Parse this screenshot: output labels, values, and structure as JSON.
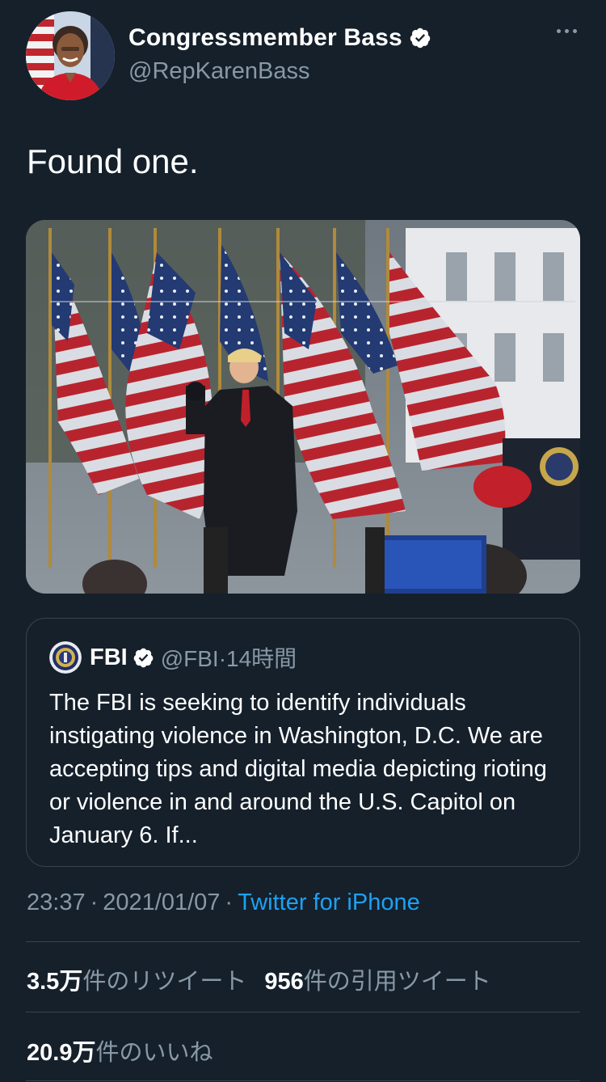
{
  "author": {
    "display_name": "Congressmember Bass",
    "handle": "@RepKarenBass",
    "avatar_icon": "profile-avatar",
    "verified_icon": "verified-badge-icon"
  },
  "tweet": {
    "text": "Found one."
  },
  "quoted_tweet": {
    "name": "FBI",
    "handle": "@FBI",
    "separator": "·",
    "time": "14時間",
    "text": "The FBI is seeking to identify individuals instigating violence in Washington, D.C. We are accepting tips and digital media depicting rioting or violence in and around the U.S. Capitol on January 6. If..."
  },
  "meta": {
    "time": "23:37",
    "separator": "·",
    "date": "2021/01/07",
    "separator2": "·",
    "source": "Twitter for iPhone"
  },
  "stats": {
    "retweets_count": "3.5万",
    "retweets_label": "件のリツイート",
    "quotes_count": "956",
    "quotes_label": "件の引用ツイート",
    "likes_count": "20.9万",
    "likes_label": "件のいいね"
  },
  "colors": {
    "background": "#15202b",
    "secondary_text": "#8899a6",
    "link": "#1da1f2",
    "border": "#38444d"
  }
}
